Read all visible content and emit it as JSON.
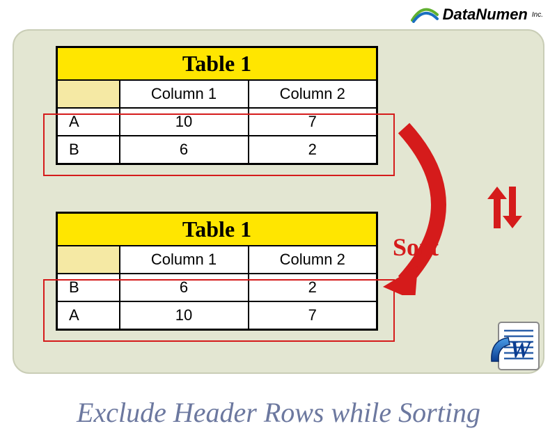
{
  "logo": {
    "text": "DataNumen",
    "suffix": "Inc."
  },
  "caption": "Exclude Header Rows while Sorting",
  "sort_label": "Sort",
  "tables": [
    {
      "title": "Table 1",
      "headers": [
        "",
        "Column 1",
        "Column 2"
      ],
      "rows": [
        {
          "label": "A",
          "c1": "10",
          "c2": "7"
        },
        {
          "label": "B",
          "c1": "6",
          "c2": "2"
        }
      ]
    },
    {
      "title": "Table 1",
      "headers": [
        "",
        "Column 1",
        "Column 2"
      ],
      "rows": [
        {
          "label": "B",
          "c1": "6",
          "c2": "2"
        },
        {
          "label": "A",
          "c1": "10",
          "c2": "7"
        }
      ]
    }
  ]
}
